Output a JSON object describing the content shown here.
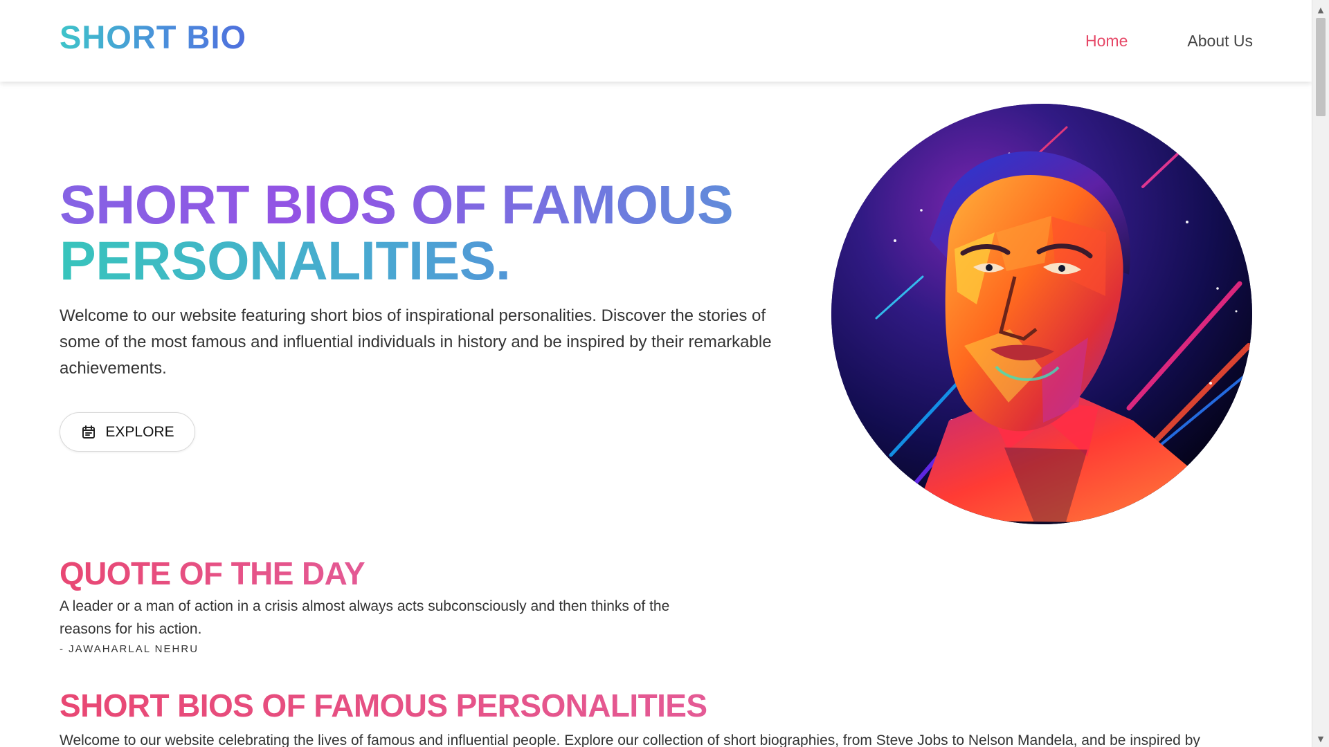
{
  "header": {
    "brand": "SHORT BIO",
    "nav": [
      {
        "label": "Home",
        "active": true
      },
      {
        "label": "About Us",
        "active": false
      }
    ]
  },
  "hero": {
    "title_line_1": "SHORT BIOS OF FAMOUS",
    "title_line_2": "PERSONALITIES.",
    "description": "Welcome to our website featuring short bios of inspirational personalities. Discover the stories of some of the most famous and influential individuals in history and be inspired by their remarkable achievements.",
    "cta_label": "EXPLORE",
    "cta_icon": "calendar-icon",
    "portrait_icon": "portrait-icon"
  },
  "quote": {
    "title": "QUOTE OF THE DAY",
    "text": "A leader or a man of action in a crisis almost always acts subconsciously and then thinks of the reasons for his action.",
    "author": "- JAWAHARLAL NEHRU"
  },
  "bios": {
    "title": "SHORT BIOS OF FAMOUS PERSONALITIES",
    "text": "Welcome to our website celebrating the lives of famous and influential people. Explore our collection of short biographies, from Steve Jobs to Nelson Mandela, and be inspired by"
  },
  "colors": {
    "active_nav": "#e64766",
    "section_heading": "#e84773",
    "brand_start": "#3ec4c9",
    "brand_end": "#4f6fdd",
    "hero_purple": "#8563e4",
    "hero_teal": "#38c4bc"
  }
}
